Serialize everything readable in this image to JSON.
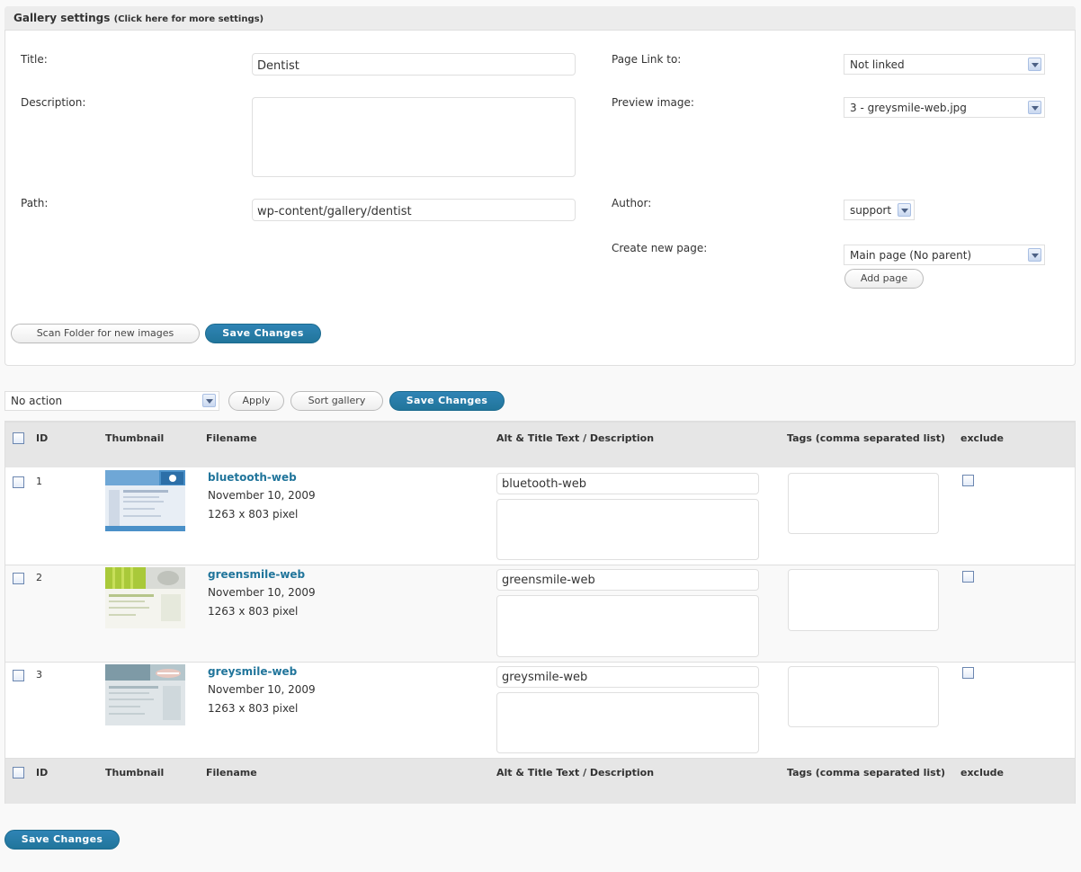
{
  "settings": {
    "header_title": "Gallery settings",
    "header_link": "(Click here for more settings)",
    "title_label": "Title:",
    "title_value": "Dentist",
    "description_label": "Description:",
    "description_value": "",
    "path_label": "Path:",
    "path_value": "wp-content/gallery/dentist",
    "page_link_label": "Page Link to:",
    "page_link_value": "Not linked",
    "preview_label": "Preview image:",
    "preview_value": "3 - greysmile-web.jpg",
    "author_label": "Author:",
    "author_value": "support",
    "create_page_label": "Create new page:",
    "create_page_value": "Main page (No parent)",
    "add_page_button": "Add page",
    "scan_button": "Scan Folder for new images",
    "save_button": "Save Changes"
  },
  "toolbar": {
    "bulk_action": "No action",
    "apply_button": "Apply",
    "sort_button": "Sort gallery",
    "save_button": "Save Changes"
  },
  "table": {
    "columns": [
      "ID",
      "Thumbnail",
      "Filename",
      "Alt & Title Text / Description",
      "Tags (comma separated list)",
      "exclude"
    ],
    "rows": [
      {
        "id": "1",
        "filename": "bluetooth-web",
        "date": "November 10, 2009",
        "size": "1263 x 803 pixel",
        "alt": "bluetooth-web",
        "description": "",
        "tags": ""
      },
      {
        "id": "2",
        "filename": "greensmile-web",
        "date": "November 10, 2009",
        "size": "1263 x 803 pixel",
        "alt": "greensmile-web",
        "description": "",
        "tags": ""
      },
      {
        "id": "3",
        "filename": "greysmile-web",
        "date": "November 10, 2009",
        "size": "1263 x 803 pixel",
        "alt": "greysmile-web",
        "description": "",
        "tags": ""
      }
    ]
  },
  "footer": {
    "save_button": "Save Changes"
  },
  "colors": {
    "primary": "#21759b",
    "header_bg": "#e6e6e6"
  }
}
